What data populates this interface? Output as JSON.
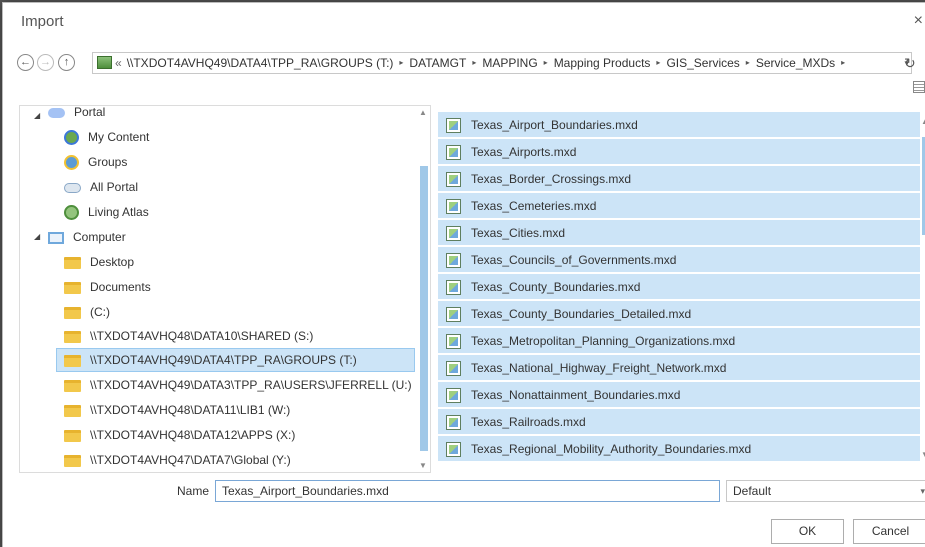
{
  "window": {
    "title": "Import",
    "close_glyph": "×"
  },
  "nav": {
    "back_glyph": "←",
    "forward_glyph": "→",
    "up_glyph": "↑",
    "overflow": "«",
    "breadcrumbs": [
      "\\\\TXDOT4AVHQ49\\DATA4\\TPP_RA\\GROUPS (T:)",
      "DATAMGT",
      "MAPPING",
      "Mapping Products",
      "GIS_Services",
      "Service_MXDs"
    ],
    "separator": "▸",
    "dropdown_glyph": "▾",
    "refresh_glyph": "↻"
  },
  "tree": {
    "expand_glyph": "◢",
    "items": [
      {
        "label": "Portal",
        "icon": "portal-icon"
      },
      {
        "label": "My Content",
        "icon": "my-content-icon"
      },
      {
        "label": "Groups",
        "icon": "groups-icon"
      },
      {
        "label": "All Portal",
        "icon": "cloud-icon"
      },
      {
        "label": "Living Atlas",
        "icon": "globe-icon"
      },
      {
        "label": "Computer",
        "icon": "computer-icon"
      },
      {
        "label": "Desktop",
        "icon": "folder-icon"
      },
      {
        "label": "Documents",
        "icon": "folder-icon"
      },
      {
        "label": "(C:)",
        "icon": "folder-icon"
      },
      {
        "label": "\\\\TXDOT4AVHQ48\\DATA10\\SHARED (S:)",
        "icon": "folder-icon"
      },
      {
        "label": "\\\\TXDOT4AVHQ49\\DATA4\\TPP_RA\\GROUPS (T:)",
        "icon": "folder-icon",
        "selected": true
      },
      {
        "label": "\\\\TXDOT4AVHQ49\\DATA3\\TPP_RA\\USERS\\JFERRELL (U:)",
        "icon": "folder-icon"
      },
      {
        "label": "\\\\TXDOT4AVHQ48\\DATA11\\LIB1 (W:)",
        "icon": "folder-icon"
      },
      {
        "label": "\\\\TXDOT4AVHQ48\\DATA12\\APPS (X:)",
        "icon": "folder-icon"
      },
      {
        "label": "\\\\TXDOT4AVHQ47\\DATA7\\Global (Y:)",
        "icon": "folder-icon"
      }
    ]
  },
  "files": [
    "Texas_Airport_Boundaries.mxd",
    "Texas_Airports.mxd",
    "Texas_Border_Crossings.mxd",
    "Texas_Cemeteries.mxd",
    "Texas_Cities.mxd",
    "Texas_Councils_of_Governments.mxd",
    "Texas_County_Boundaries.mxd",
    "Texas_County_Boundaries_Detailed.mxd",
    "Texas_Metropolitan_Planning_Organizations.mxd",
    "Texas_National_Highway_Freight_Network.mxd",
    "Texas_Nonattainment_Boundaries.mxd",
    "Texas_Railroads.mxd",
    "Texas_Regional_Mobility_Authority_Boundaries.mxd"
  ],
  "footer": {
    "name_label": "Name",
    "name_value": "Texas_Airport_Boundaries.mxd",
    "filter_value": "Default",
    "ok_label": "OK",
    "cancel_label": "Cancel"
  },
  "colors": {
    "selection": "#cce4f7",
    "selection_border": "#99c9ef",
    "scroll_thumb": "#a0c8e8"
  }
}
